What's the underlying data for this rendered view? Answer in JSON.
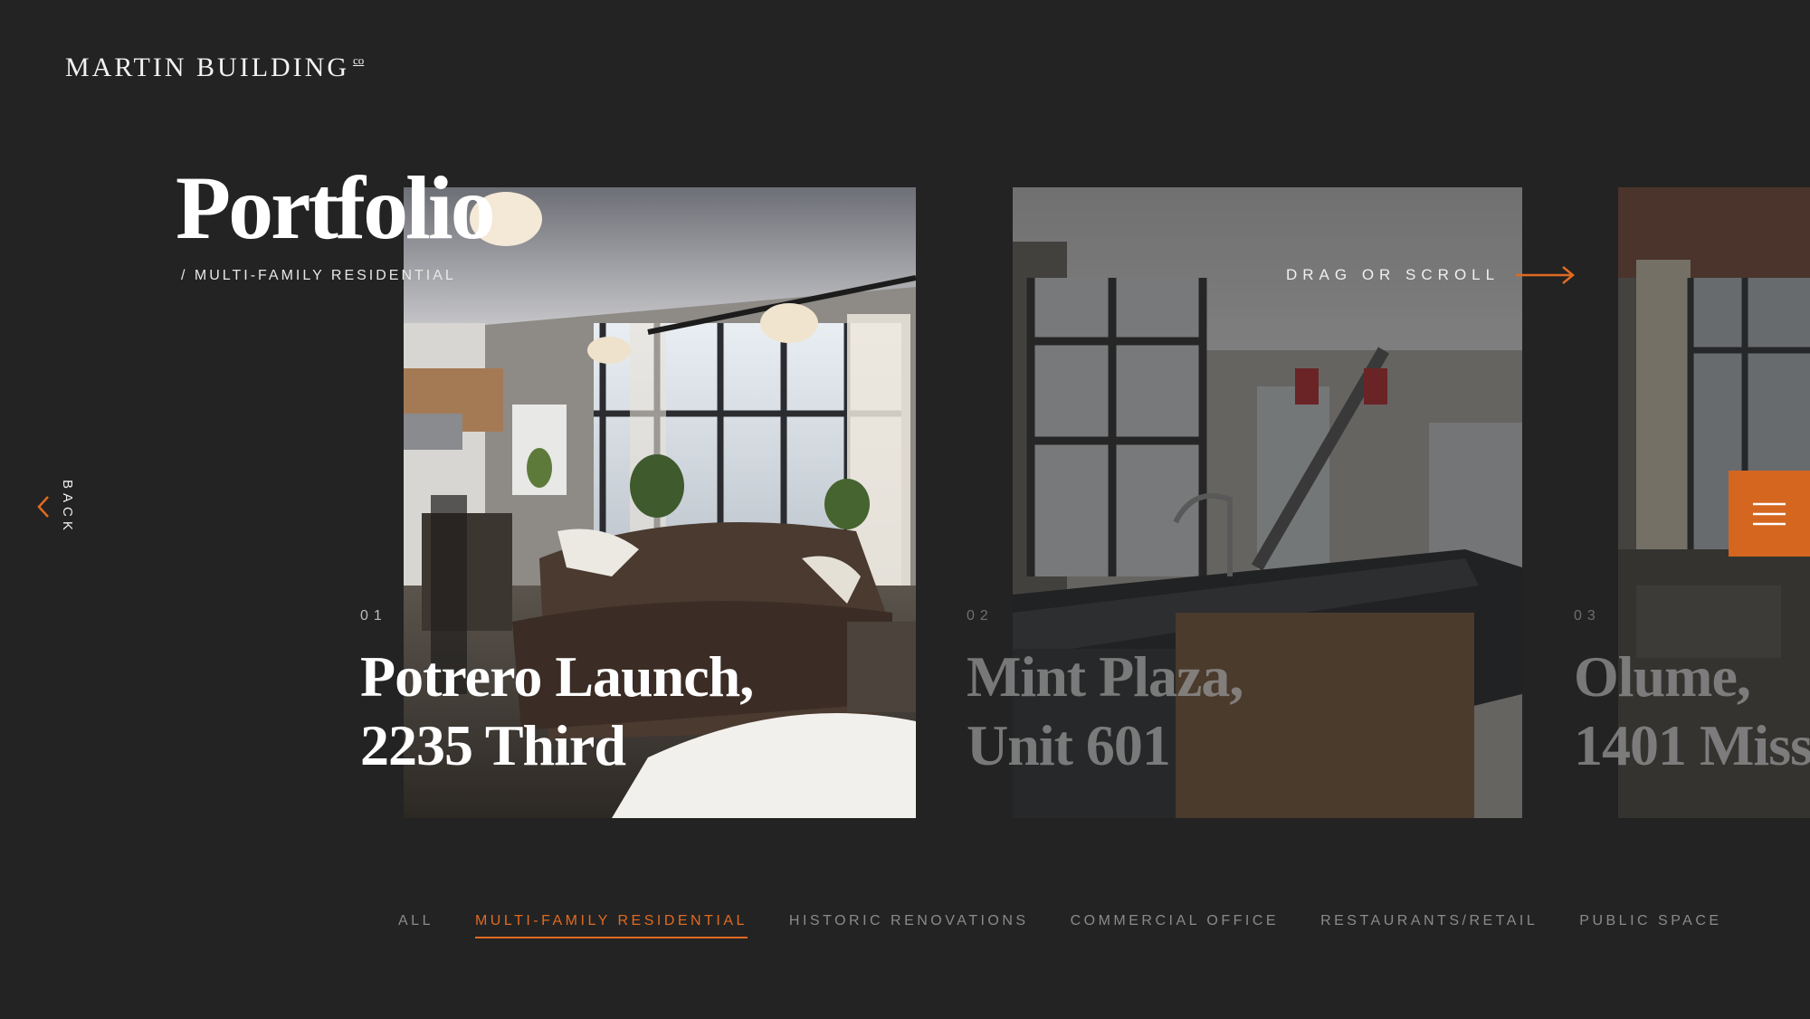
{
  "logo": {
    "name": "MARTIN BUILDING",
    "suffix": "co"
  },
  "page": {
    "title": "Portfolio",
    "subtitle": "/ MULTI-FAMILY RESIDENTIAL"
  },
  "drag_hint": "DRAG OR SCROLL",
  "back_label": "BACK",
  "projects": [
    {
      "number": "01",
      "line1": "Potrero Launch,",
      "line2": "2235 Third"
    },
    {
      "number": "02",
      "line1": "Mint Plaza,",
      "line2": "Unit 601"
    },
    {
      "number": "03",
      "line1": "Olume,",
      "line2": "1401 Miss"
    }
  ],
  "filters": [
    {
      "label": "ALL",
      "active": false
    },
    {
      "label": "MULTI-FAMILY RESIDENTIAL",
      "active": true
    },
    {
      "label": "HISTORIC RENOVATIONS",
      "active": false
    },
    {
      "label": "COMMERCIAL OFFICE",
      "active": false
    },
    {
      "label": "RESTAURANTS/RETAIL",
      "active": false
    },
    {
      "label": "PUBLIC SPACE",
      "active": false
    }
  ],
  "colors": {
    "accent": "#e06a22",
    "background": "#232323",
    "menu": "#d4661f"
  },
  "icons": {
    "back": "chevron-left-icon",
    "drag": "arrow-right-icon",
    "menu": "hamburger-icon"
  }
}
